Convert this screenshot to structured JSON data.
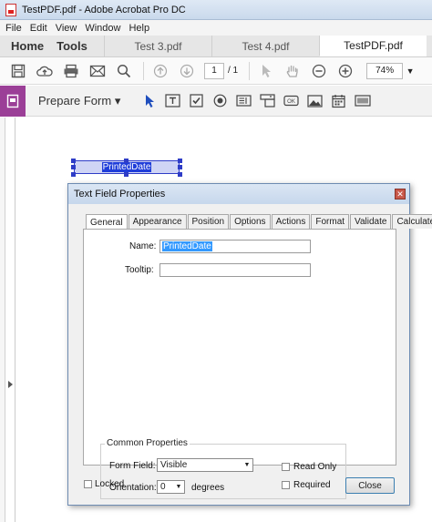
{
  "window": {
    "title": "TestPDF.pdf - Adobe Acrobat Pro DC"
  },
  "menu": [
    "File",
    "Edit",
    "View",
    "Window",
    "Help"
  ],
  "nav": {
    "home": "Home",
    "tools": "Tools"
  },
  "doc_tabs": [
    {
      "label": "Test 3.pdf",
      "active": false
    },
    {
      "label": "Test 4.pdf",
      "active": false
    },
    {
      "label": "TestPDF.pdf",
      "active": true
    }
  ],
  "toolbar": {
    "icons": [
      "save-icon",
      "upload-icon",
      "print-icon",
      "mail-icon",
      "search-icon",
      "page-up-icon",
      "page-down-icon"
    ],
    "page_current": "1",
    "page_total": "/ 1",
    "zoom": "74%"
  },
  "form_bar": {
    "label": "Prepare Form",
    "accent": "#9b3f97"
  },
  "pdf_field": {
    "label": "PrintedDate"
  },
  "dialog": {
    "title": "Text Field Properties",
    "tabs": [
      "General",
      "Appearance",
      "Position",
      "Options",
      "Actions",
      "Format",
      "Validate",
      "Calculate"
    ],
    "active_tab": "General",
    "name_label": "Name:",
    "name_value": "PrintedDate",
    "tooltip_label": "Tooltip:",
    "tooltip_value": "",
    "common_title": "Common Properties",
    "form_field_label": "Form Field:",
    "form_field_value": "Visible",
    "orientation_label": "Orientation:",
    "orientation_value": "0",
    "degrees_label": "degrees",
    "read_only_label": "Read Only",
    "required_label": "Required",
    "locked_label": "Locked",
    "close_label": "Close"
  }
}
